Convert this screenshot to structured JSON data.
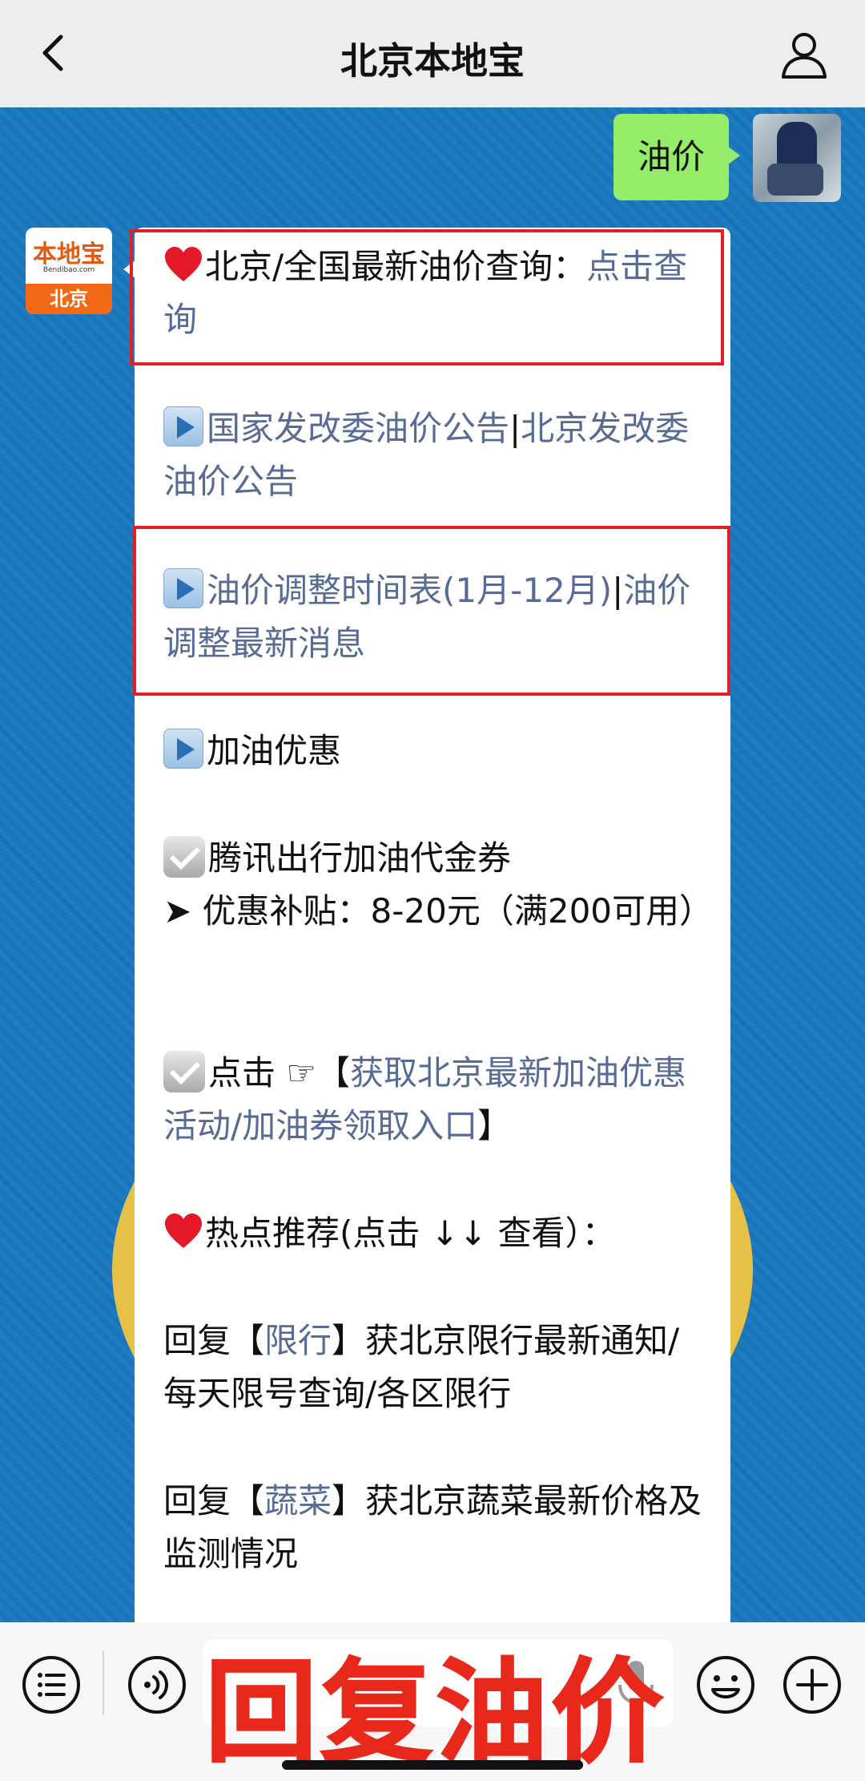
{
  "header": {
    "title": "北京本地宝"
  },
  "chat": {
    "my_message": "油价",
    "bot_avatar": {
      "logo_text": "本地宝",
      "logo_sub": "Bendibao.com",
      "logo_city": "北京"
    },
    "reply": {
      "line1_text": "北京/全国最新油价查询：",
      "line1_link": "点击查询",
      "line2_link_a": "国家发改委油价公告",
      "line2_sep": "|",
      "line2_link_b": "北京发改委油价公告",
      "line3_link_a": "油价调整时间表(1月-12月)",
      "line3_sep": "|",
      "line3_link_b": "油价调整最新消息",
      "line4_link": "加油优惠",
      "line5_text": "腾讯出行加油代金券",
      "line6_text": "➤ 优惠补贴：8-20元（满200可用）",
      "line7_prefix": "点击 ☞【",
      "line7_link": "获取北京最新加油优惠活动/加油券领取入口",
      "line7_suffix": "】",
      "line8_text": "热点推荐(点击 ↓↓ 查看）：",
      "line9_prefix": "回复【",
      "line9_link": "限行",
      "line9_suffix": "】获北京限行最新通知/每天限号查询/各区限行",
      "line10_prefix": "回复【",
      "line10_link": "蔬菜",
      "line10_suffix": "】获北京蔬菜最新价格及监测情况"
    }
  },
  "bottom": {
    "overlay_text": "回复油价"
  },
  "colors": {
    "link": "#576b95",
    "highlight_border": "#e21e26",
    "overlay": "#e8281a",
    "my_bubble": "#95ec69"
  },
  "icons": [
    "back-arrow-icon",
    "profile-icon",
    "menu-list-icon",
    "voice-icon",
    "mic-icon",
    "emoji-icon",
    "plus-icon",
    "heart-icon",
    "play-icon",
    "check-icon"
  ]
}
